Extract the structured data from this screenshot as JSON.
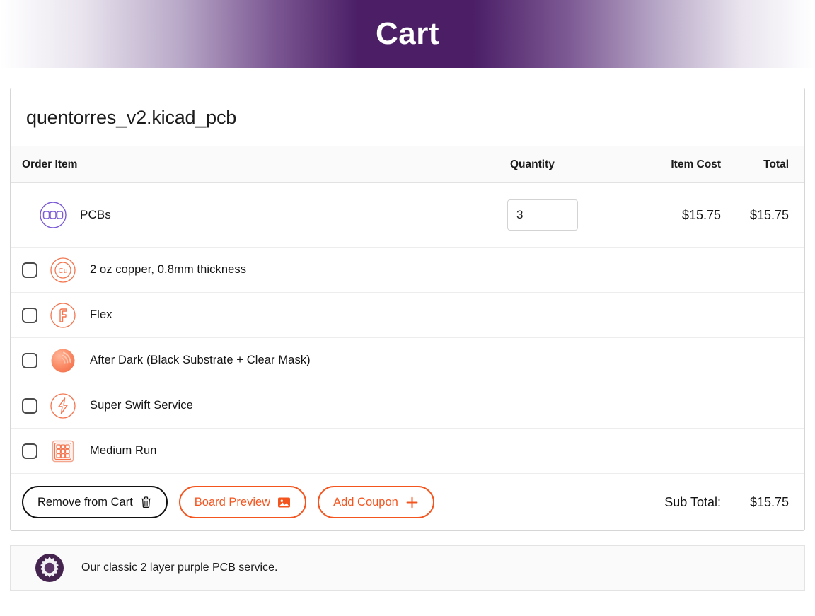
{
  "header": {
    "title": "Cart",
    "gradient_center_color": "#4b1e66",
    "title_color": "#ffffff"
  },
  "cart": {
    "filename": "quentorres_v2.kicad_pcb",
    "columns": {
      "order_item": "Order Item",
      "quantity": "Quantity",
      "item_cost": "Item Cost",
      "total": "Total"
    },
    "main_row": {
      "icon": "pcb-stack-icon",
      "label": "PCBs",
      "quantity_value": "3",
      "item_cost": "$15.75",
      "total": "$15.75",
      "accent_color": "#7b5bd6"
    },
    "option_rows": [
      {
        "icon": "copper-icon",
        "label": "2 oz copper, 0.8mm thickness",
        "checked": false
      },
      {
        "icon": "flex-icon",
        "label": "Flex",
        "checked": false
      },
      {
        "icon": "after-dark-icon",
        "label": "After Dark (Black Substrate + Clear Mask)",
        "checked": false
      },
      {
        "icon": "lightning-icon",
        "label": "Super Swift Service",
        "checked": false
      },
      {
        "icon": "grid-run-icon",
        "label": "Medium Run",
        "checked": false
      }
    ],
    "option_accent_color": "#f4754f",
    "footer": {
      "remove_button": "Remove from Cart",
      "remove_icon": "trash-icon",
      "preview_button": "Board Preview",
      "preview_icon": "image-icon",
      "coupon_button": "Add Coupon",
      "coupon_icon": "plus-icon",
      "subtotal_label": "Sub Total:",
      "subtotal_value": "$15.75",
      "orange_color": "#f4551f"
    }
  },
  "note": {
    "icon": "gear-icon",
    "text": "Our classic 2 layer purple PCB service.",
    "icon_color": "#45234f"
  }
}
